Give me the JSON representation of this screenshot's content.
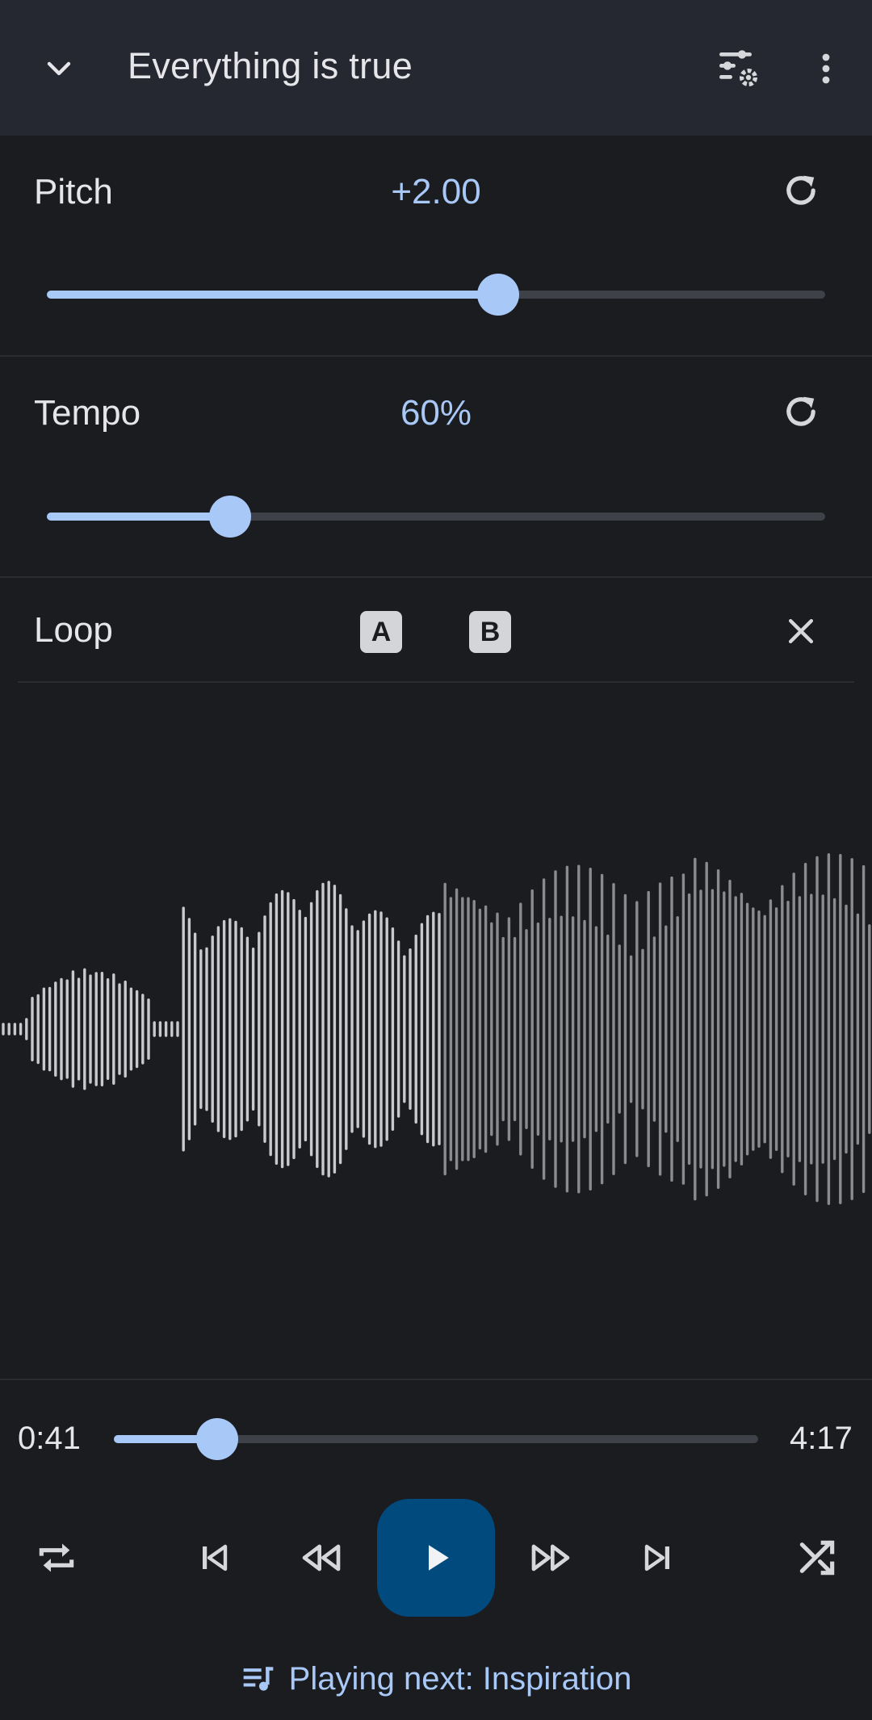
{
  "header": {
    "title": "Everything is true",
    "icons": [
      "chevron-down-icon",
      "equalizer-settings-icon",
      "more-vert-icon"
    ]
  },
  "pitch": {
    "label": "Pitch",
    "value": "+2.00",
    "slider_fraction": 0.58
  },
  "tempo": {
    "label": "Tempo",
    "value": "60%",
    "slider_fraction": 0.235
  },
  "loop": {
    "label": "Loop",
    "a_label": "A",
    "b_label": "B"
  },
  "playback": {
    "current_time": "0:41",
    "total_time": "4:17",
    "progress_fraction": 0.16
  },
  "controls": {
    "icons": [
      "repeat-icon",
      "skip-previous-icon",
      "rewind-icon",
      "play-icon",
      "fast-forward-icon",
      "skip-next-icon",
      "shuffle-icon"
    ]
  },
  "playing_next": {
    "text": "Playing next: Inspiration"
  },
  "colors": {
    "accent": "#a8c8f8",
    "play_button": "#004a7e",
    "header_bg": "#252830",
    "bg": "#1b1c1f",
    "wave_played": "#c8c9cd",
    "wave_unplayed": "#8a8b8f"
  }
}
